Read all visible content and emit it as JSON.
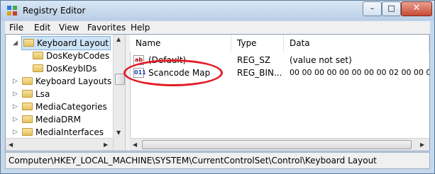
{
  "window": {
    "title": "Registry Editor"
  },
  "menu": [
    "File",
    "Edit",
    "View",
    "Favorites",
    "Help"
  ],
  "tree": {
    "items": [
      {
        "label": "Keyboard Layout",
        "selected": true,
        "expanded": true
      },
      {
        "label": "DosKeybCodes"
      },
      {
        "label": "DosKeybIDs"
      },
      {
        "label": "Keyboard Layouts"
      },
      {
        "label": "Lsa"
      },
      {
        "label": "MediaCategories"
      },
      {
        "label": "MediaDRM"
      },
      {
        "label": "MediaInterfaces"
      }
    ]
  },
  "list": {
    "columns": [
      "Name",
      "Type",
      "Data"
    ],
    "rows": [
      {
        "icon": "string-value-icon",
        "name": "(Default)",
        "type": "REG_SZ",
        "data": "(value not set)"
      },
      {
        "icon": "binary-value-icon",
        "name": "Scancode Map",
        "type": "REG_BIN...",
        "data": "00 00 00 00 00 00 00 00 02 00 00 00 00 0"
      }
    ]
  },
  "status": {
    "path": "Computer\\HKEY_LOCAL_MACHINE\\SYSTEM\\CurrentControlSet\\Control\\Keyboard Layout"
  },
  "icons": {
    "string": "ab",
    "binary": "011"
  },
  "colors": {
    "annotation": "#e21a25",
    "selection": "#cde3f6"
  }
}
